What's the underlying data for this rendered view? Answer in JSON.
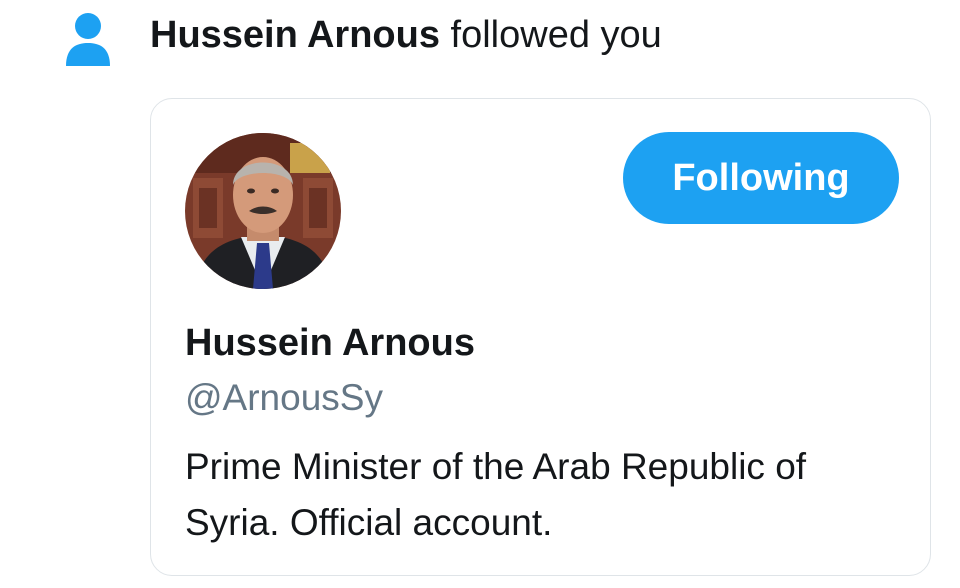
{
  "notification": {
    "icon": "person-icon",
    "actor_name": "Hussein Arnous",
    "action_text": "followed you"
  },
  "card": {
    "avatar": "profile-photo",
    "follow_button_label": "Following",
    "display_name": "Hussein Arnous",
    "handle": "@ArnousSy",
    "bio": "Prime Minister of the Arab Republic of Syria. Official account."
  },
  "colors": {
    "accent": "#1da1f2",
    "secondary_text": "#657786",
    "primary_text": "#14171a",
    "border": "#dfe4e8"
  }
}
